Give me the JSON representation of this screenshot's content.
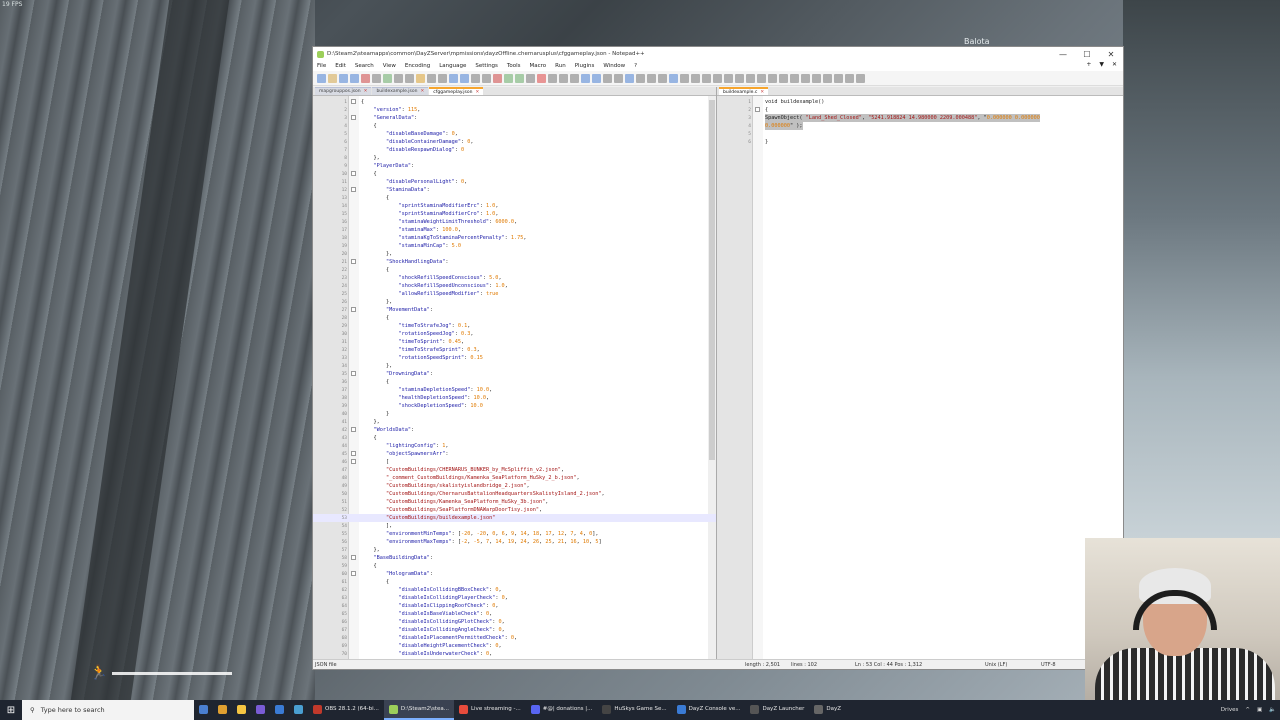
{
  "game": {
    "fps": "19 FPS",
    "location": "Balota"
  },
  "window": {
    "title": "D:\\Steam2\\steamapps\\common\\DayZServer\\mpmissions\\dayzOffline.chernarusplus\\cfggameplay.json - Notepad++",
    "minimize": "—",
    "maximize": "☐",
    "close": "✕"
  },
  "menu": [
    "File",
    "Edit",
    "Search",
    "View",
    "Encoding",
    "Language",
    "Settings",
    "Tools",
    "Macro",
    "Run",
    "Plugins",
    "Window",
    "?"
  ],
  "menu_right": [
    "+",
    "▼",
    "✕"
  ],
  "left_tabs": [
    {
      "label": "mapgrouppos.json"
    },
    {
      "label": "buildexample.json"
    },
    {
      "label": "cfggameplay.json",
      "active": true
    }
  ],
  "right_tabs": [
    {
      "label": "buildexample.c",
      "active": true
    }
  ],
  "left_lines": [
    {
      "n": "1",
      "t": "{"
    },
    {
      "n": "2",
      "t": "    \"version\": 115,"
    },
    {
      "n": "3",
      "t": "    \"GeneralData\":"
    },
    {
      "n": "4",
      "t": "    {"
    },
    {
      "n": "5",
      "t": "        \"disableBaseDamage\": 0,"
    },
    {
      "n": "6",
      "t": "        \"disableContainerDamage\": 0,"
    },
    {
      "n": "7",
      "t": "        \"disableRespawnDialog\": 0"
    },
    {
      "n": "8",
      "t": "    },"
    },
    {
      "n": "9",
      "t": "    \"PlayerData\":"
    },
    {
      "n": "10",
      "t": "    {"
    },
    {
      "n": "11",
      "t": "        \"disablePersonalLight\": 0,"
    },
    {
      "n": "12",
      "t": "        \"StaminaData\":"
    },
    {
      "n": "13",
      "t": "        {"
    },
    {
      "n": "14",
      "t": "            \"sprintStaminaModifierErc\": 1.0,"
    },
    {
      "n": "15",
      "t": "            \"sprintStaminaModifierCro\": 1.0,"
    },
    {
      "n": "16",
      "t": "            \"staminaWeightLimitThreshold\": 6000.0,"
    },
    {
      "n": "17",
      "t": "            \"staminaMax\": 100.0,"
    },
    {
      "n": "18",
      "t": "            \"staminaKgToStaminaPercentPenalty\": 1.75,"
    },
    {
      "n": "19",
      "t": "            \"staminaMinCap\": 5.0"
    },
    {
      "n": "20",
      "t": "        },"
    },
    {
      "n": "21",
      "t": "        \"ShockHandlingData\":"
    },
    {
      "n": "22",
      "t": "        {"
    },
    {
      "n": "23",
      "t": "            \"shockRefillSpeedConscious\": 5.0,"
    },
    {
      "n": "24",
      "t": "            \"shockRefillSpeedUnconscious\": 1.0,"
    },
    {
      "n": "25",
      "t": "            \"allowRefillSpeedModifier\": true"
    },
    {
      "n": "26",
      "t": "        },"
    },
    {
      "n": "27",
      "t": "        \"MovementData\":"
    },
    {
      "n": "28",
      "t": "        {"
    },
    {
      "n": "29",
      "t": "            \"timeToStrafeJog\": 0.1,"
    },
    {
      "n": "30",
      "t": "            \"rotationSpeedJog\": 0.3,"
    },
    {
      "n": "31",
      "t": "            \"timeToSprint\": 0.45,"
    },
    {
      "n": "32",
      "t": "            \"timeToStrafeSprint\": 0.3,"
    },
    {
      "n": "33",
      "t": "            \"rotationSpeedSprint\": 0.15"
    },
    {
      "n": "34",
      "t": "        },"
    },
    {
      "n": "35",
      "t": "        \"DrowningData\":"
    },
    {
      "n": "36",
      "t": "        {"
    },
    {
      "n": "37",
      "t": "            \"staminaDepletionSpeed\": 10.0,"
    },
    {
      "n": "38",
      "t": "            \"healthDepletionSpeed\": 10.0,"
    },
    {
      "n": "39",
      "t": "            \"shockDepletionSpeed\": 10.0"
    },
    {
      "n": "40",
      "t": "        }"
    },
    {
      "n": "41",
      "t": "    },"
    },
    {
      "n": "42",
      "t": "    \"WorldsData\":"
    },
    {
      "n": "43",
      "t": "    {"
    },
    {
      "n": "44",
      "t": "        \"lightingConfig\": 1,"
    },
    {
      "n": "45",
      "t": "        \"objectSpawnersArr\":"
    },
    {
      "n": "46",
      "t": "        ["
    },
    {
      "n": "47",
      "t": "        \"CustomBuildings/CHERNARUS_BUNKER_by_McSpliffin_v2.json\","
    },
    {
      "n": "48",
      "t": "        \"_comment_CustomBuildings/Kamenka_SeaPlatform_HuSky_2_b.json\","
    },
    {
      "n": "49",
      "t": "        \"CustomBuildings/skalistyislandbridge_2.json\","
    },
    {
      "n": "50",
      "t": "        \"CustomBuildings/ChernarusBattalionHeadquartersSkalistyIsland_2.json\","
    },
    {
      "n": "51",
      "t": "        \"CustomBuildings/Kamenka_SeaPlatform_HuSky_3b.json\","
    },
    {
      "n": "52",
      "t": "        \"CustomBuildings/SeaPlatformDNAWarpDoorTisy.json\","
    },
    {
      "n": "53",
      "t": "        \"CustomBuildings/buildexample.json\"",
      "current": true
    },
    {
      "n": "54",
      "t": "        ],"
    },
    {
      "n": "55",
      "t": "        \"environmentMinTemps\": [-20, -20, 0, 6, 9, 14, 18, 17, 12, 7, 4, 0],"
    },
    {
      "n": "56",
      "t": "        \"environmentMaxTemps\": [-2, -5, 7, 14, 19, 24, 26, 25, 21, 16, 10, 5]"
    },
    {
      "n": "57",
      "t": "    },"
    },
    {
      "n": "58",
      "t": "    \"BaseBuildingData\":"
    },
    {
      "n": "59",
      "t": "    {"
    },
    {
      "n": "60",
      "t": "        \"HologramData\":"
    },
    {
      "n": "61",
      "t": "        {"
    },
    {
      "n": "62",
      "t": "            \"disableIsCollidingBBoxCheck\": 0,"
    },
    {
      "n": "63",
      "t": "            \"disableIsCollidingPlayerCheck\": 0,"
    },
    {
      "n": "64",
      "t": "            \"disableIsClippingRoofCheck\": 0,"
    },
    {
      "n": "65",
      "t": "            \"disableIsBaseViableCheck\": 0,"
    },
    {
      "n": "66",
      "t": "            \"disableIsCollidingGPlotCheck\": 0,"
    },
    {
      "n": "67",
      "t": "            \"disableIsCollidingAngleCheck\": 0,"
    },
    {
      "n": "68",
      "t": "            \"disableIsPlacementPermittedCheck\": 0,"
    },
    {
      "n": "69",
      "t": "            \"disableHeightPlacementCheck\": 0,"
    },
    {
      "n": "70",
      "t": "            \"disableIsUnderwaterCheck\": 0,"
    }
  ],
  "right_lines": [
    {
      "n": "1",
      "t": "void buildexample()"
    },
    {
      "n": "2",
      "t": "{"
    },
    {
      "n": "3",
      "t": "SpawnObject( \"Land_Shed_Closed\", \"5241.918824 14.980000 2209.000488\", \"0.000000 0.000000",
      "sel": true
    },
    {
      "n": "4",
      "t": "0.000000\" );",
      "sel": true
    },
    {
      "n": "5",
      "t": ""
    },
    {
      "n": "6",
      "t": "}"
    }
  ],
  "status": {
    "type": "JSON file",
    "length": "length : 2,501",
    "lines": "lines : 102",
    "pos": "Ln : 53    Col : 44    Pos : 1,312",
    "eol": "Unix (LF)",
    "enc": "UTF-8"
  },
  "taskbar": {
    "search_placeholder": "Type here to search",
    "items": [
      {
        "label": "OBS 28.1.2 (64-bi...",
        "color": "#c0392b"
      },
      {
        "label": "D:\\Steam2\\stea...",
        "color": "#9ccf5a",
        "active": true
      },
      {
        "label": "Live streaming -...",
        "color": "#e74c3c"
      },
      {
        "label": "#@| donations |...",
        "color": "#5865f2"
      },
      {
        "label": "HuSkys Game Se...",
        "color": "#444"
      },
      {
        "label": "DayZ Console ve...",
        "color": "#3a7bd5"
      },
      {
        "label": "DayZ Launcher",
        "color": "#555"
      },
      {
        "label": "DayZ",
        "color": "#666"
      }
    ],
    "tray_label": "Drives"
  }
}
